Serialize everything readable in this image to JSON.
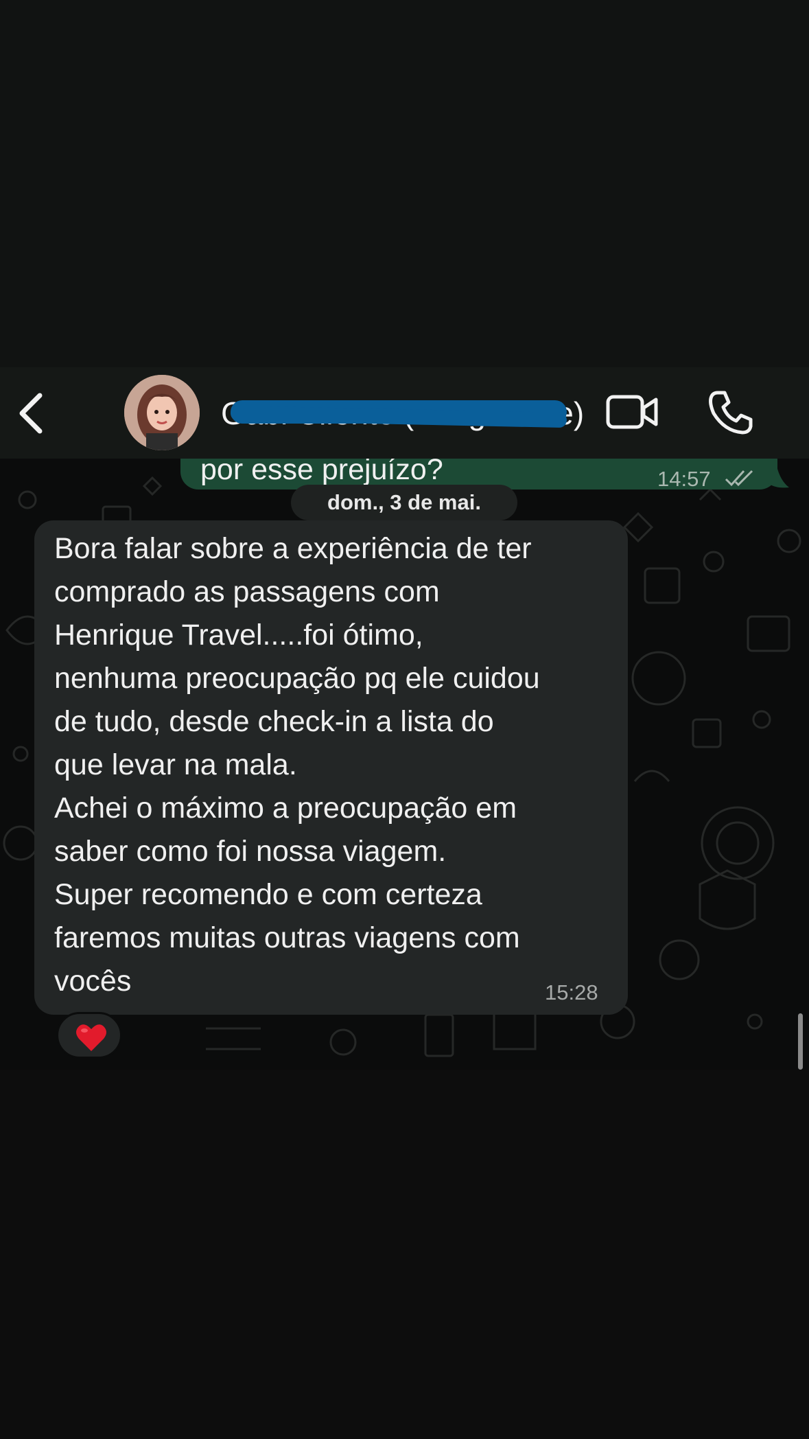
{
  "header": {
    "contact_name": "Gabi Cliente (Amiga Mãe)",
    "back_icon": "chevron-left-icon",
    "video_icon": "video-camera-icon",
    "call_icon": "phone-icon"
  },
  "messages": {
    "outgoing": {
      "text": "por esse prejuízo?",
      "time": "14:57",
      "status_icon": "double-check-icon"
    },
    "date_separator": "dom., 3 de mai.",
    "incoming": {
      "lines": [
        "Bora falar sobre a experiência de ter",
        "comprado as passagens com",
        "Henrique Travel.....foi ótimo,",
        "nenhuma preocupação pq ele cuidou",
        "de tudo, desde check-in a lista do",
        "que levar na mala.",
        "Achei o máximo a preocupação em",
        "saber como foi nossa viagem.",
        "Super recomendo e com certeza",
        "faremos muitas outras viagens com",
        "vocês"
      ],
      "time": "15:28",
      "reaction": "❤️"
    }
  },
  "colors": {
    "outgoing_bubble": "#1c4a35",
    "incoming_bubble": "#232626",
    "redaction": "#0a5f9a"
  }
}
